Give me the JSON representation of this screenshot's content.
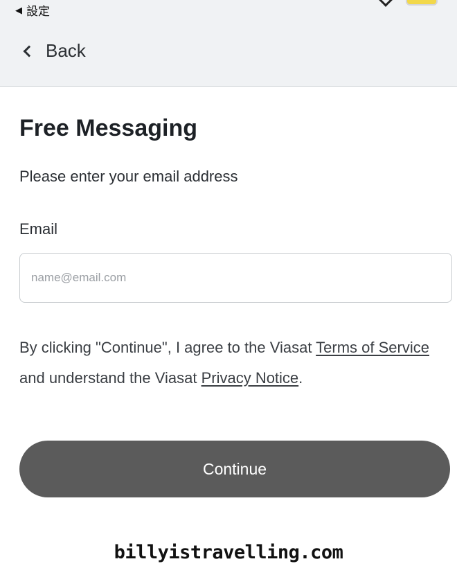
{
  "status_bar": {
    "back_app_label": "設定",
    "back_glyph": "◀"
  },
  "nav": {
    "back_label": "Back"
  },
  "page": {
    "title": "Free Messaging",
    "instruction": "Please enter your email address"
  },
  "form": {
    "email_label": "Email",
    "email_value": "",
    "email_placeholder": "name@email.com"
  },
  "consent": {
    "prefix": "By clicking \"Continue\", I agree to the Viasat ",
    "terms_link": "Terms of Service",
    "middle": " and understand the Viasat ",
    "privacy_link": "Privacy Notice",
    "suffix": "."
  },
  "actions": {
    "continue_label": "Continue"
  },
  "watermark": {
    "text": "billyistravelling.com"
  },
  "colors": {
    "header_bg": "#f0f2f4",
    "button_bg": "#5b5b5b",
    "text_primary": "#1d2126",
    "battery": "#f2d84a"
  }
}
